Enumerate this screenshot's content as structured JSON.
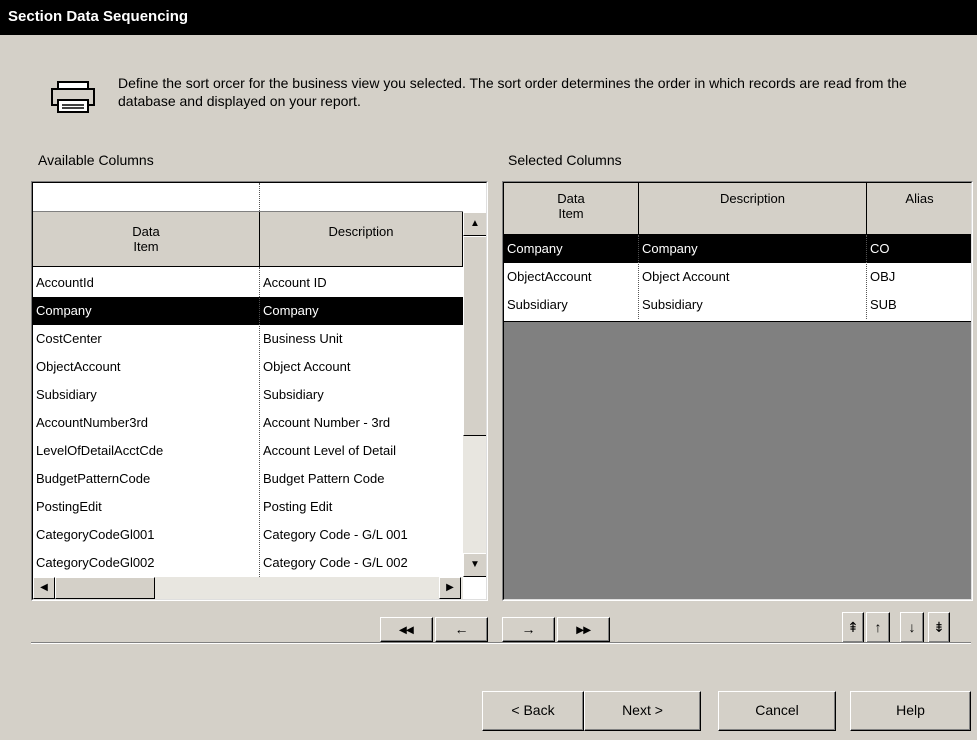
{
  "dialog": {
    "title": "Section Data Sequencing"
  },
  "intro": {
    "text": "Define the sort orcer for the business view you selected.  The sort order determines the order in which records are read from the database and displayed on your report."
  },
  "available": {
    "label": "Available Columns",
    "headers": {
      "data_item": "Data\nItem",
      "description": "Description"
    },
    "selected_index": 1,
    "rows": [
      {
        "item": "AccountId",
        "desc": "Account ID"
      },
      {
        "item": "Company",
        "desc": "Company"
      },
      {
        "item": "CostCenter",
        "desc": "Business Unit"
      },
      {
        "item": "ObjectAccount",
        "desc": "Object Account"
      },
      {
        "item": "Subsidiary",
        "desc": "Subsidiary"
      },
      {
        "item": "AccountNumber3rd",
        "desc": "Account Number - 3rd"
      },
      {
        "item": "LevelOfDetailAcctCde",
        "desc": "Account Level of Detail"
      },
      {
        "item": "BudgetPatternCode",
        "desc": "Budget Pattern Code"
      },
      {
        "item": "PostingEdit",
        "desc": "Posting Edit"
      },
      {
        "item": "CategoryCodeGl001",
        "desc": "Category Code - G/L 001"
      },
      {
        "item": "CategoryCodeGl002",
        "desc": "Category Code - G/L 002"
      }
    ]
  },
  "selected": {
    "label": "Selected Columns",
    "headers": {
      "data_item": "Data\nItem",
      "description": "Description",
      "alias": "Alias"
    },
    "selected_index": 0,
    "rows": [
      {
        "item": "Company",
        "desc": "Company",
        "alias": "CO"
      },
      {
        "item": "ObjectAccount",
        "desc": "Object Account",
        "alias": "OBJ"
      },
      {
        "item": "Subsidiary",
        "desc": "Subsidiary",
        "alias": "SUB"
      }
    ]
  },
  "move_buttons": {
    "remove_all": "◂◂",
    "remove": "←",
    "add": "→",
    "add_all": "▸▸"
  },
  "order_buttons": {
    "top": "⇞",
    "up": "↑",
    "down": "↓",
    "bottom": "⇟"
  },
  "footer": {
    "back": "< Back",
    "next": "Next >",
    "cancel": "Cancel",
    "help": "Help"
  },
  "icons": {
    "intro": "printer-icon"
  }
}
